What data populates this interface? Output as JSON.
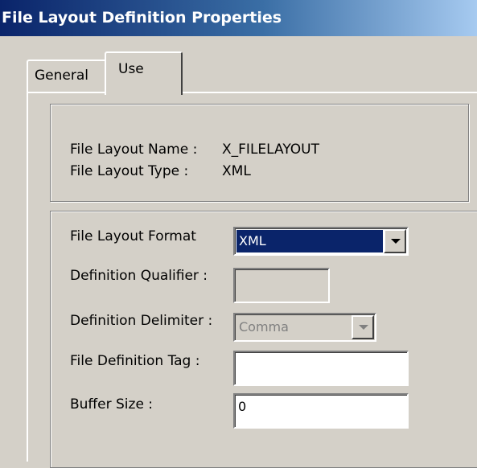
{
  "window": {
    "title": "File Layout Definition Properties"
  },
  "tabs": [
    {
      "label": "General"
    },
    {
      "label": "Use"
    }
  ],
  "info": {
    "name_label": "File Layout Name :",
    "name_value": "X_FILELAYOUT",
    "type_label": "File Layout Type :",
    "type_value": "XML"
  },
  "format": {
    "format_label": "File Layout Format",
    "format_value": "XML",
    "qualifier_label": "Definition Qualifier :",
    "qualifier_value": "",
    "delimiter_label": "Definition Delimiter :",
    "delimiter_value": "Comma",
    "tag_label": "File Definition Tag :",
    "tag_value": "",
    "buffer_label": "Buffer Size :",
    "buffer_value": "0"
  }
}
